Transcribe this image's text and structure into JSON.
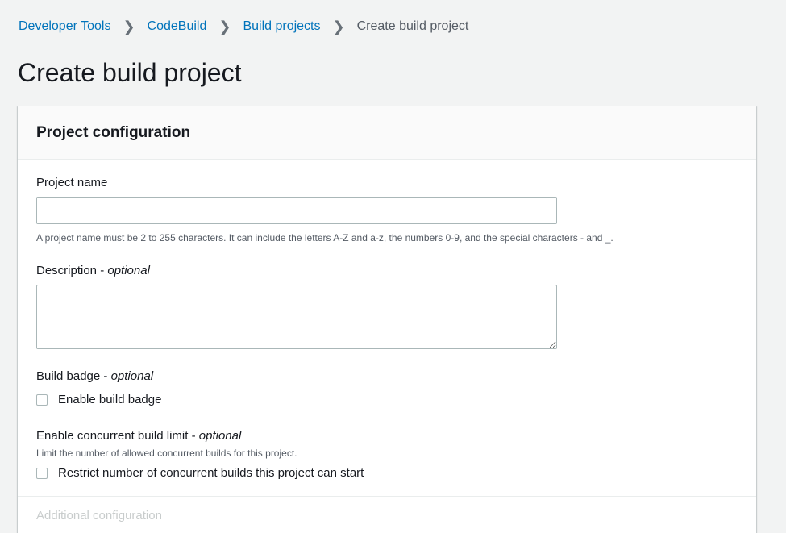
{
  "breadcrumb": {
    "items": [
      "Developer Tools",
      "CodeBuild",
      "Build projects"
    ],
    "current": "Create build project"
  },
  "page": {
    "title": "Create build project"
  },
  "panel": {
    "title": "Project configuration",
    "project_name": {
      "label": "Project name",
      "value": "",
      "hint": "A project name must be 2 to 255 characters. It can include the letters A-Z and a-z, the numbers 0-9, and the special characters - and _."
    },
    "description": {
      "label": "Description",
      "optional": "optional",
      "value": ""
    },
    "build_badge": {
      "label": "Build badge",
      "optional": "optional",
      "checkbox_label": "Enable build badge",
      "checked": false
    },
    "concurrent_limit": {
      "label": "Enable concurrent build limit",
      "optional": "optional",
      "hint": "Limit the number of allowed concurrent builds for this project.",
      "checkbox_label": "Restrict number of concurrent builds this project can start",
      "checked": false
    },
    "next_section_partial": "Additional configuration"
  }
}
